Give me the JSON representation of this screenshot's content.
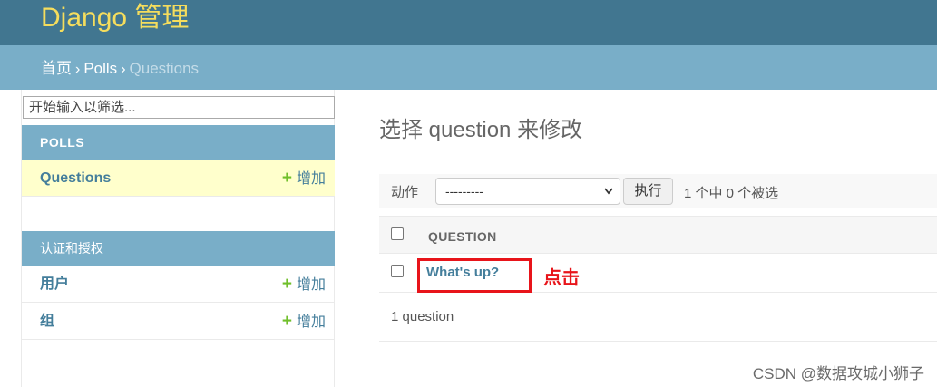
{
  "header": {
    "site_name": "Django 管理"
  },
  "breadcrumbs": {
    "home": "首页",
    "sep": "›",
    "app": "Polls",
    "current": "Questions"
  },
  "sidebar": {
    "filter_placeholder": "开始输入以筛选...",
    "modules": [
      {
        "caption": "POLLS",
        "models": [
          {
            "label": "Questions",
            "add": "增加"
          }
        ]
      },
      {
        "caption": "认证和授权",
        "models": [
          {
            "label": "用户",
            "add": "增加"
          },
          {
            "label": "组",
            "add": "增加"
          }
        ]
      }
    ],
    "plus_icon": "+"
  },
  "content": {
    "title": "选择 question 来修改",
    "actions": {
      "label": "动作",
      "selected": "---------",
      "go": "执行",
      "counter": "1 个中 0 个被选"
    },
    "table": {
      "column": "QUESTION",
      "rows": [
        {
          "question": "What's up?"
        }
      ]
    },
    "annotation": "点击",
    "paginator": "1 question"
  },
  "watermark": "CSDN @数据攻城小狮子",
  "colors": {
    "header": "#417690",
    "breadcrumbs": "#79aec8",
    "site_name": "#f5dd5d",
    "link": "#447e9b",
    "add_icon": "#70bf2b",
    "annotation": "#e8141a",
    "current_row": "#ffffcc"
  }
}
